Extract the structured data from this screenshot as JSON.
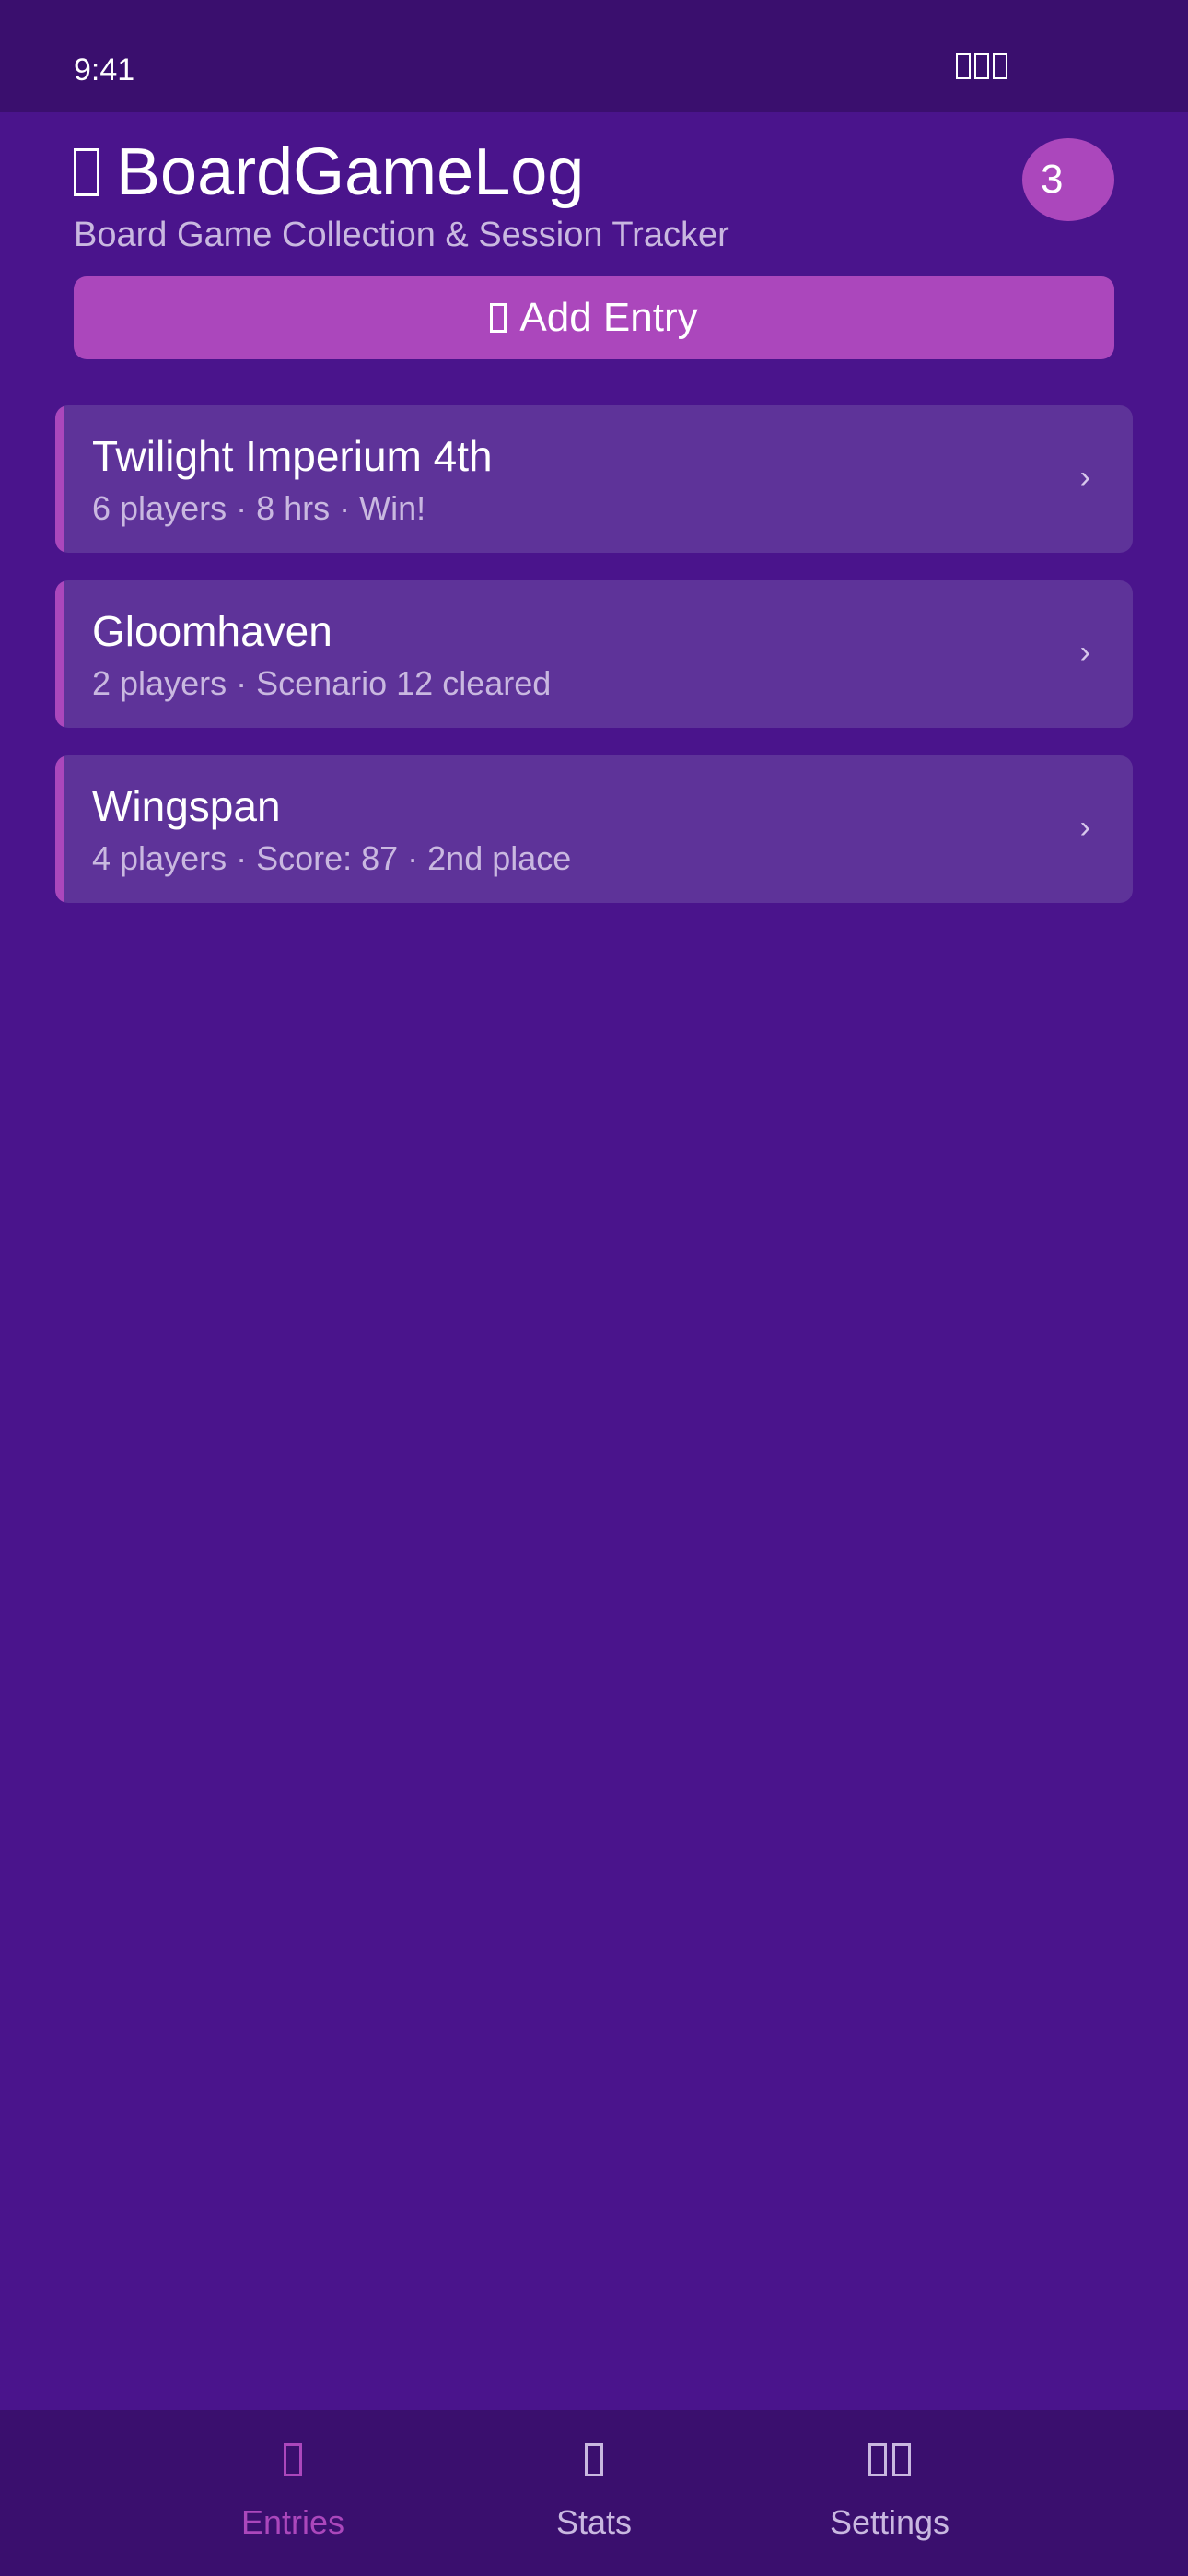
{
  "status_bar": {
    "time": "9:41"
  },
  "header": {
    "title": "BoardGameLog",
    "subtitle": "Board Game Collection & Session Tracker",
    "count_badge": "3"
  },
  "add_button": {
    "label": "Add Entry"
  },
  "entries": [
    {
      "title": "Twilight Imperium 4th",
      "meta": "6 players · 8 hrs · Win!"
    },
    {
      "title": "Gloomhaven",
      "meta": "2 players · Scenario 12 cleared"
    },
    {
      "title": "Wingspan",
      "meta": "4 players · Score: 87 · 2nd place"
    }
  ],
  "chevron_glyph": "›",
  "bottom_nav": {
    "items": [
      {
        "label": "Entries",
        "icon": "entries-icon",
        "active": true
      },
      {
        "label": "Stats",
        "icon": "stats-icon",
        "active": false
      },
      {
        "label": "Settings",
        "icon": "settings-icon",
        "active": false
      }
    ]
  },
  "colors": {
    "background": "#4a148c",
    "bar": "#3a0f6e",
    "accent": "#ab47bc",
    "card": "#5e3399",
    "muted_text": "#c9b8e0"
  }
}
